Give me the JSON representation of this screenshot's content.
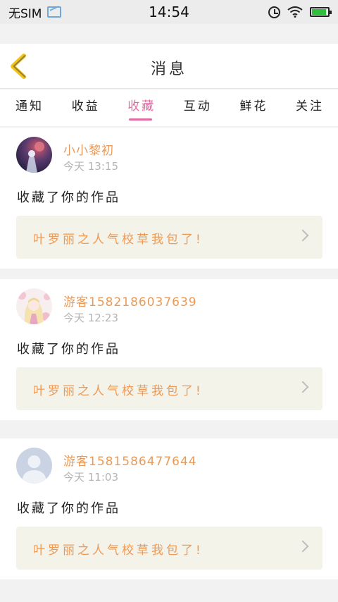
{
  "status_bar": {
    "carrier": "无SIM",
    "time": "14:54",
    "battery_level": 0.9,
    "battery_color": "#2fbf3d"
  },
  "header": {
    "title": "消息",
    "back_icon": "chevron-left-icon",
    "back_color": "#f2c41b"
  },
  "tabs": [
    {
      "label": "通知",
      "active": false
    },
    {
      "label": "收益",
      "active": false
    },
    {
      "label": "收藏",
      "active": true
    },
    {
      "label": "互动",
      "active": false
    },
    {
      "label": "鲜花",
      "active": false
    },
    {
      "label": "关注",
      "active": false
    }
  ],
  "accent_color": "#e36aa2",
  "messages": [
    {
      "user": "小小黎初",
      "time": "今天 13:15",
      "action": "收藏了你的作品",
      "work_title": "叶罗丽之人气校草我包了!",
      "avatar": "anime-night-avatar"
    },
    {
      "user": "游客1582186037639",
      "time": "今天 12:23",
      "action": "收藏了你的作品",
      "work_title": "叶罗丽之人气校草我包了!",
      "avatar": "anime-girl-avatar"
    },
    {
      "user": "游客1581586477644",
      "time": "今天 11:03",
      "action": "收藏了你的作品",
      "work_title": "叶罗丽之人气校草我包了!",
      "avatar": "default-user-avatar"
    }
  ]
}
